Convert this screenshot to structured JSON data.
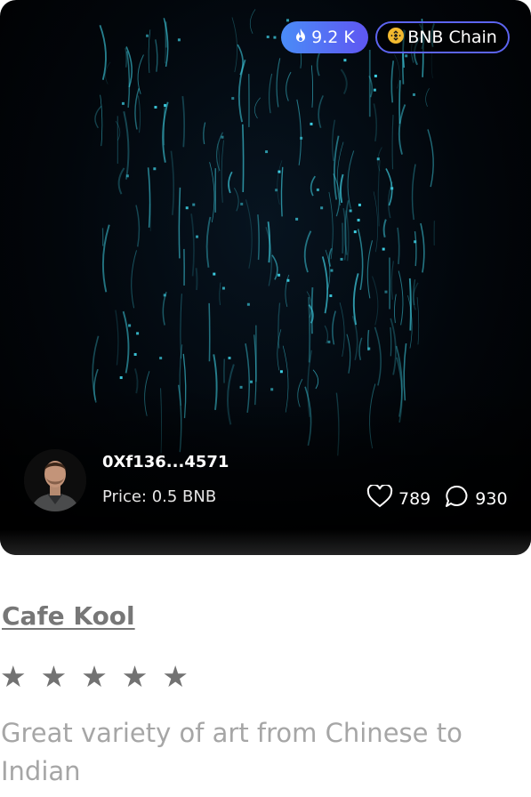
{
  "card": {
    "views_badge": {
      "icon": "flame-icon",
      "label": "9.2 K"
    },
    "chain_badge": {
      "icon": "bnb-logo-icon",
      "label": "BNB Chain"
    },
    "owner": {
      "address": "0Xf136...4571",
      "avatar": "avatar-photo"
    },
    "price_label": "Price: 0.5 BNB",
    "likes": {
      "icon": "heart-icon",
      "count": "789"
    },
    "comments": {
      "icon": "comment-icon",
      "count": "930"
    }
  },
  "listing": {
    "title": "Cafe Kool",
    "rating": {
      "filled": 5,
      "max": 5
    },
    "description": "Great variety of art from Chinese to Indian"
  },
  "colors": {
    "badge_gradient_start": "#4a8cf7",
    "badge_gradient_end": "#5f56f2",
    "bnb_yellow": "#f3ba2f",
    "rain_teal": "#3fd2e6"
  }
}
